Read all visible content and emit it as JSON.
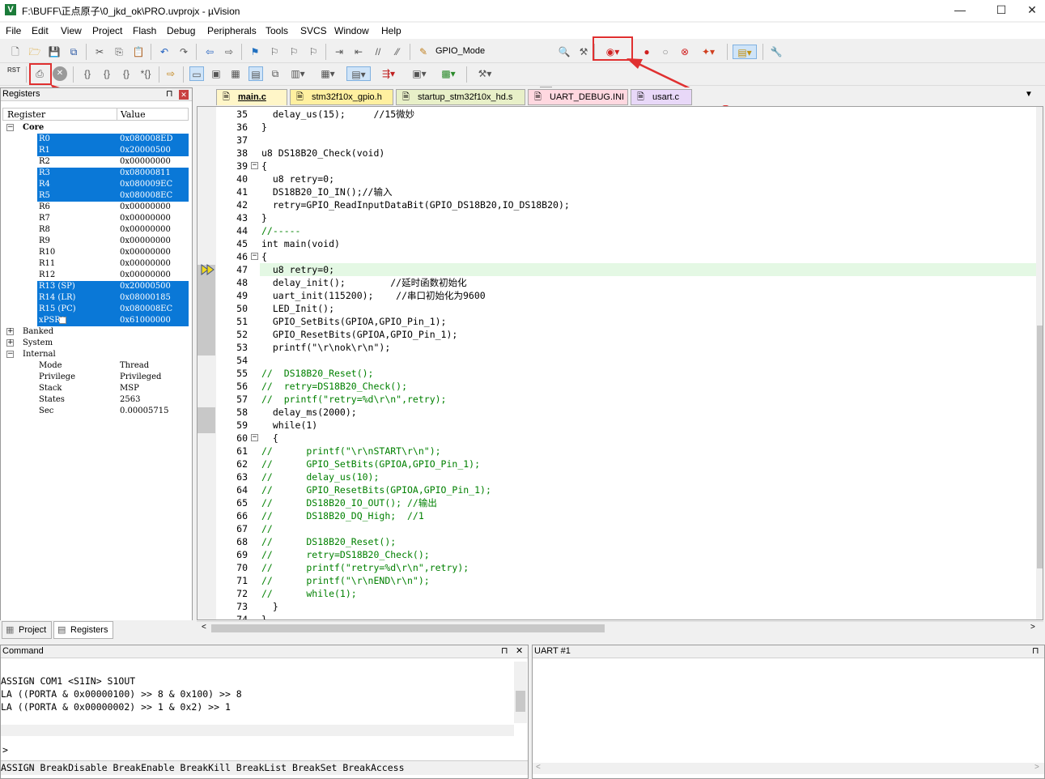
{
  "window": {
    "title": "F:\\BUFF\\正点原子\\0_jkd_ok\\PRO.uvprojx - µVision",
    "minimize": "—",
    "maximize": "☐",
    "close": "✕"
  },
  "menu": [
    "File",
    "Edit",
    "View",
    "Project",
    "Flash",
    "Debug",
    "Peripherals",
    "Tools",
    "SVCS",
    "Window",
    "Help"
  ],
  "toolbar": {
    "target_combo": "GPIO_Mode",
    "rst_label": "RST"
  },
  "registers": {
    "panel_title": "Registers",
    "col_register": "Register",
    "col_value": "Value",
    "groups": {
      "core": "Core",
      "banked": "Banked",
      "system": "System",
      "internal": "Internal"
    },
    "core": [
      {
        "name": "R0",
        "value": "0x080008ED",
        "sel": true
      },
      {
        "name": "R1",
        "value": "0x20000500",
        "sel": true
      },
      {
        "name": "R2",
        "value": "0x00000000",
        "sel": false
      },
      {
        "name": "R3",
        "value": "0x08000811",
        "sel": true
      },
      {
        "name": "R4",
        "value": "0x080009EC",
        "sel": true
      },
      {
        "name": "R5",
        "value": "0x080008EC",
        "sel": true
      },
      {
        "name": "R6",
        "value": "0x00000000",
        "sel": false
      },
      {
        "name": "R7",
        "value": "0x00000000",
        "sel": false
      },
      {
        "name": "R8",
        "value": "0x00000000",
        "sel": false
      },
      {
        "name": "R9",
        "value": "0x00000000",
        "sel": false
      },
      {
        "name": "R10",
        "value": "0x00000000",
        "sel": false
      },
      {
        "name": "R11",
        "value": "0x00000000",
        "sel": false
      },
      {
        "name": "R12",
        "value": "0x00000000",
        "sel": false
      },
      {
        "name": "R13 (SP)",
        "value": "0x20000500",
        "sel": true
      },
      {
        "name": "R14 (LR)",
        "value": "0x08000185",
        "sel": true
      },
      {
        "name": "R15 (PC)",
        "value": "0x080008EC",
        "sel": true
      },
      {
        "name": "xPSR",
        "value": "0x61000000",
        "sel": true
      }
    ],
    "internal": [
      {
        "name": "Mode",
        "value": "Thread"
      },
      {
        "name": "Privilege",
        "value": "Privileged"
      },
      {
        "name": "Stack",
        "value": "MSP"
      },
      {
        "name": "States",
        "value": "2563"
      },
      {
        "name": "Sec",
        "value": "0.00005715"
      }
    ],
    "tabs": {
      "project": "Project",
      "registers": "Registers"
    }
  },
  "editor_tabs": [
    {
      "label": "main.c",
      "color": "#fff6c8",
      "active": true
    },
    {
      "label": "stm32f10x_gpio.h",
      "color": "#fff0a0",
      "active": false
    },
    {
      "label": "startup_stm32f10x_hd.s",
      "color": "#e8f0c8",
      "active": false
    },
    {
      "label": "UART_DEBUG.INI",
      "color": "#ffd8e0",
      "active": false
    },
    {
      "label": "usart.c",
      "color": "#e8d8f8",
      "active": false
    }
  ],
  "code": [
    {
      "n": "35",
      "t": "  delay_us(15);     //15微妙"
    },
    {
      "n": "36",
      "t": "}"
    },
    {
      "n": "37",
      "t": ""
    },
    {
      "n": "38",
      "t": "u8 DS18B20_Check(void)"
    },
    {
      "n": "39",
      "t": "{"
    },
    {
      "n": "40",
      "t": "  u8 retry=0;"
    },
    {
      "n": "41",
      "t": "  DS18B20_IO_IN();//输入"
    },
    {
      "n": "42",
      "t": "  retry=GPIO_ReadInputDataBit(GPIO_DS18B20,IO_DS18B20);"
    },
    {
      "n": "43",
      "t": "}"
    },
    {
      "n": "44",
      "t": "//-----"
    },
    {
      "n": "45",
      "t": "int main(void)"
    },
    {
      "n": "46",
      "t": "{"
    },
    {
      "n": "47",
      "t": "  u8 retry=0;"
    },
    {
      "n": "48",
      "t": "  delay_init();        //延时函数初始化"
    },
    {
      "n": "49",
      "t": "  uart_init(115200);    //串口初始化为9600"
    },
    {
      "n": "50",
      "t": "  LED_Init();"
    },
    {
      "n": "51",
      "t": "  GPIO_SetBits(GPIOA,GPIO_Pin_1);"
    },
    {
      "n": "52",
      "t": "  GPIO_ResetBits(GPIOA,GPIO_Pin_1);"
    },
    {
      "n": "53",
      "t": "  printf(\"\\r\\nok\\r\\n\");"
    },
    {
      "n": "54",
      "t": ""
    },
    {
      "n": "55",
      "t": "//  DS18B20_Reset();"
    },
    {
      "n": "56",
      "t": "//  retry=DS18B20_Check();"
    },
    {
      "n": "57",
      "t": "//  printf(\"retry=%d\\r\\n\",retry);"
    },
    {
      "n": "58",
      "t": "  delay_ms(2000);"
    },
    {
      "n": "59",
      "t": "  while(1)"
    },
    {
      "n": "60",
      "t": "  {"
    },
    {
      "n": "61",
      "t": "//      printf(\"\\r\\nSTART\\r\\n\");"
    },
    {
      "n": "62",
      "t": "//      GPIO_SetBits(GPIOA,GPIO_Pin_1);"
    },
    {
      "n": "63",
      "t": "//      delay_us(10);"
    },
    {
      "n": "64",
      "t": "//      GPIO_ResetBits(GPIOA,GPIO_Pin_1);"
    },
    {
      "n": "65",
      "t": "//      DS18B20_IO_OUT(); //输出"
    },
    {
      "n": "66",
      "t": "//      DS18B20_DQ_High;  //1"
    },
    {
      "n": "67",
      "t": "//"
    },
    {
      "n": "68",
      "t": "//      DS18B20_Reset();"
    },
    {
      "n": "69",
      "t": "//      retry=DS18B20_Check();"
    },
    {
      "n": "70",
      "t": "//      printf(\"retry=%d\\r\\n\",retry);"
    },
    {
      "n": "71",
      "t": "//      printf(\"\\r\\nEND\\r\\n\");"
    },
    {
      "n": "72",
      "t": "//      while(1);"
    },
    {
      "n": "73",
      "t": "  }"
    },
    {
      "n": "74",
      "t": "}"
    }
  ],
  "command": {
    "title": "Command",
    "lines": [
      "ASSIGN COM1 <S1IN> S1OUT",
      "LA ((PORTA & 0x00000100) >> 8 & 0x100) >> 8",
      "LA ((PORTA & 0x00000002) >> 1 & 0x2) >> 1"
    ],
    "prompt": ">",
    "hint": "ASSIGN BreakDisable BreakEnable BreakKill BreakList BreakSet BreakAccess"
  },
  "uart": {
    "title": "UART #1"
  },
  "colors": {
    "selection": "#0a78d7",
    "annotation": "#e03030",
    "current_line": "#e4f8e4"
  }
}
